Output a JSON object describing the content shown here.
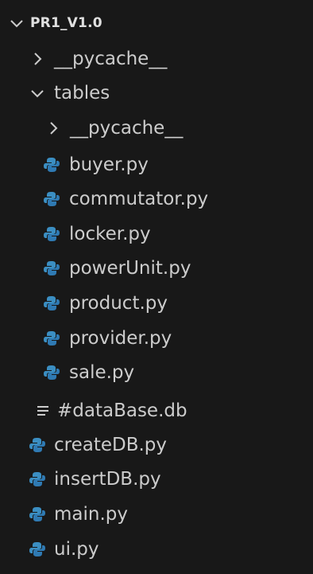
{
  "explorer": {
    "root": {
      "label": "PR1_V1.0",
      "expanded": true,
      "icon": "chevron-down-icon"
    },
    "items": [
      {
        "label": "__pycache__",
        "type": "folder",
        "expanded": false,
        "icon": "chevron-right-icon"
      },
      {
        "label": "tables",
        "type": "folder",
        "expanded": true,
        "icon": "chevron-down-icon"
      },
      {
        "label": "__pycache__",
        "type": "folder",
        "expanded": false,
        "icon": "chevron-right-icon"
      },
      {
        "label": "buyer.py",
        "type": "python-file",
        "icon": "python-icon"
      },
      {
        "label": "commutator.py",
        "type": "python-file",
        "icon": "python-icon"
      },
      {
        "label": "locker.py",
        "type": "python-file",
        "icon": "python-icon"
      },
      {
        "label": "powerUnit.py",
        "type": "python-file",
        "icon": "python-icon"
      },
      {
        "label": "product.py",
        "type": "python-file",
        "icon": "python-icon"
      },
      {
        "label": "provider.py",
        "type": "python-file",
        "icon": "python-icon"
      },
      {
        "label": "sale.py",
        "type": "python-file",
        "icon": "python-icon"
      },
      {
        "label": "#dataBase.db",
        "type": "text-file",
        "icon": "text-file-icon"
      },
      {
        "label": "createDB.py",
        "type": "python-file",
        "icon": "python-icon"
      },
      {
        "label": "insertDB.py",
        "type": "python-file",
        "icon": "python-icon"
      },
      {
        "label": "main.py",
        "type": "python-file",
        "icon": "python-icon"
      },
      {
        "label": "ui.py",
        "type": "python-file",
        "icon": "python-icon"
      }
    ]
  },
  "colors": {
    "background": "#181818",
    "text": "#cccccc",
    "python_icon": "#3b8ec2"
  }
}
